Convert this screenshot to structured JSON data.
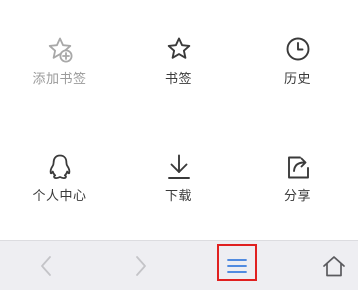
{
  "menu": {
    "items": [
      {
        "id": "add-bookmark",
        "label": "添加书签",
        "icon": "star-plus-icon",
        "enabled": false
      },
      {
        "id": "bookmarks",
        "label": "书签",
        "icon": "star-icon",
        "enabled": true
      },
      {
        "id": "history",
        "label": "历史",
        "icon": "clock-icon",
        "enabled": true
      },
      {
        "id": "profile",
        "label": "个人中心",
        "icon": "qq-penguin-icon",
        "enabled": true
      },
      {
        "id": "downloads",
        "label": "下载",
        "icon": "download-icon",
        "enabled": true
      },
      {
        "id": "share",
        "label": "分享",
        "icon": "share-icon",
        "enabled": true
      }
    ]
  },
  "toolbar": {
    "buttons": [
      {
        "id": "back",
        "icon": "chevron-left-icon",
        "enabled": false
      },
      {
        "id": "forward",
        "icon": "chevron-right-icon",
        "enabled": false
      },
      {
        "id": "menu",
        "icon": "hamburger-menu-icon",
        "enabled": true,
        "highlighted": true
      },
      {
        "id": "home",
        "icon": "home-icon",
        "enabled": true
      }
    ]
  },
  "colors": {
    "icon": "#3a3a3a",
    "icon_disabled": "#a8a8a8",
    "toolbar_bg": "#eeeef2",
    "toolbar_icon_disabled": "#c4c4c8",
    "menu_active": "#3b7ddd",
    "highlight": "#e02020"
  }
}
